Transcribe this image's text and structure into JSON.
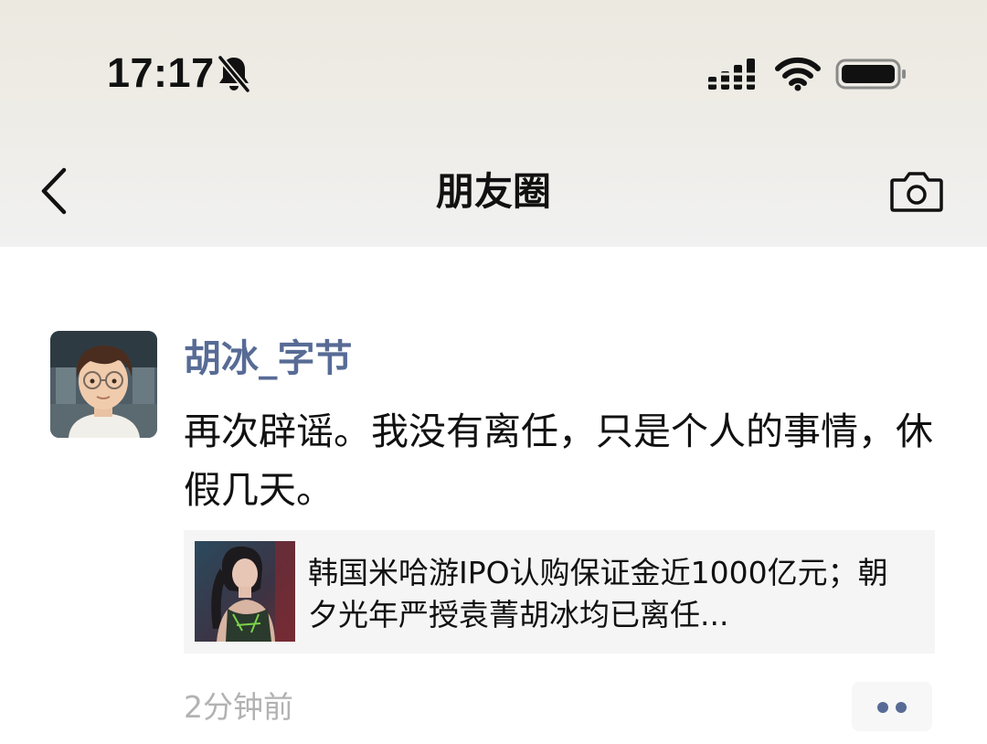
{
  "status_bar": {
    "time": "17:17",
    "icons": [
      "bell-slash-icon",
      "cellular-signal-icon",
      "wifi-icon",
      "battery-icon"
    ]
  },
  "nav": {
    "title": "朋友圈",
    "back_icon": "chevron-left-icon",
    "camera_icon": "camera-icon"
  },
  "post": {
    "username": "胡冰_字节",
    "text": "再次辟谣。我没有离任，只是个人的事情，休假几天。",
    "link": {
      "title": "韩国米哈游IPO认购保证金近1000亿元；朝夕光年严授袁菁胡冰均已离任..."
    },
    "timestamp": "2分钟前",
    "more_icon": "more-dots-icon"
  },
  "colors": {
    "username": "#576b95",
    "timestamp": "#b2b2b2",
    "card_bg": "#f5f5f5"
  }
}
